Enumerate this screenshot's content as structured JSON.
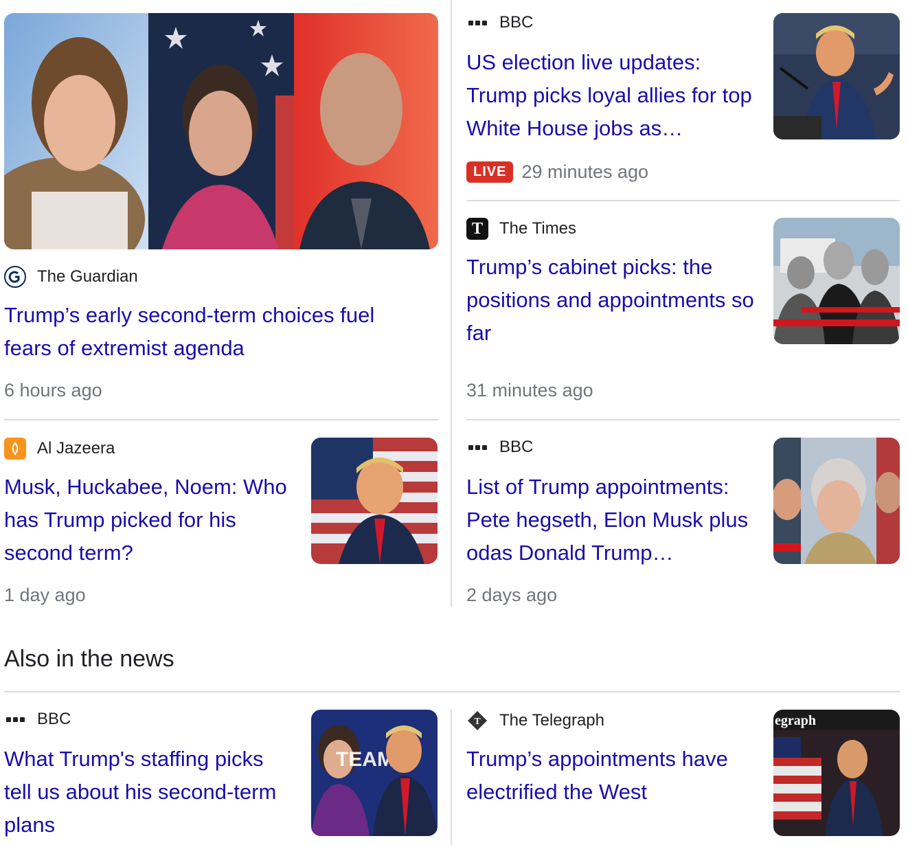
{
  "stories": [
    {
      "source": "The Guardian",
      "headline": "Trump’s early second-term choices fuel fears of extremist agenda",
      "time": "6 hours ago"
    },
    {
      "source": "BBC",
      "headline": "US election live updates: Trump picks loyal allies for top White House jobs as…",
      "badge": "LIVE",
      "time": "29 minutes ago"
    },
    {
      "source": "The Times",
      "logo_letter": "T",
      "headline": "Trump’s cabinet picks: the positions and appointments so far",
      "time": "31 minutes ago"
    },
    {
      "source": "Al Jazeera",
      "headline": "Musk, Huckabee, Noem: Who has Trump picked for his second term?",
      "time": "1 day ago"
    },
    {
      "source": "BBC",
      "headline": "List of Trump appointments: Pete hegseth, Elon Musk plus odas Donald Trump…",
      "time": "2 days ago"
    }
  ],
  "also": {
    "title": "Also in the news",
    "stories": [
      {
        "source": "BBC",
        "headline": "What Trump's staffing picks tell us about his second-term plans"
      },
      {
        "source": "The Telegraph",
        "headline": "Trump’s appointments have electrified the West"
      }
    ]
  },
  "image_text": {
    "team_sign": "TEAM",
    "telegraph_masthead": "egraph"
  },
  "colors": {
    "link": "#1a0dab",
    "meta": "#70757a",
    "live": "#d93025",
    "divider": "#dadce0"
  }
}
